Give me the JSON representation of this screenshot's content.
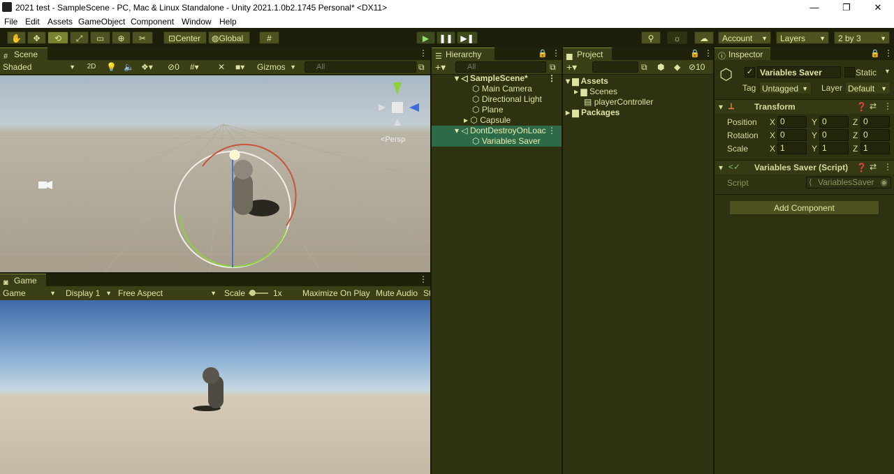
{
  "window": {
    "title": "2021 test - SampleScene - PC, Mac & Linux Standalone - Unity 2021.1.0b2.1745 Personal* <DX11>",
    "controls": {
      "minimize": "—",
      "restore": "❐",
      "close": "✕"
    }
  },
  "menu": [
    "File",
    "Edit",
    "Assets",
    "GameObject",
    "Component",
    "Window",
    "Help"
  ],
  "toolbar": {
    "pivot_label": "Center",
    "space_label": "Global",
    "account_label": "Account",
    "layers_label": "Layers",
    "layout_label": "2 by 3"
  },
  "scene": {
    "tab": "Scene",
    "shading": "Shaded",
    "mode_2d": "2D",
    "hidden_count": "0",
    "gizmos": "Gizmos",
    "search_placeholder": "All",
    "persp_label": "<Persp"
  },
  "game": {
    "tab": "Game",
    "view_dropdown": "Game",
    "display": "Display 1",
    "aspect": "Free Aspect",
    "scale_label": "Scale",
    "scale_value": "1x",
    "maximize": "Maximize On Play",
    "mute": "Mute Audio",
    "stats_cut": "St"
  },
  "hierarchy": {
    "tab": "Hierarchy",
    "search_placeholder": "All",
    "rows": [
      {
        "label": "SampleScene*"
      },
      {
        "label": "Main Camera"
      },
      {
        "label": "Directional Light"
      },
      {
        "label": "Plane"
      },
      {
        "label": "Capsule"
      },
      {
        "label": "DontDestroyOnLoac"
      },
      {
        "label": "Variables Saver"
      }
    ]
  },
  "project": {
    "tab": "Project",
    "hidden_count": "10",
    "tree": [
      {
        "label": "Assets"
      },
      {
        "label": "Scenes"
      },
      {
        "label": "playerController"
      },
      {
        "label": "Packages"
      }
    ]
  },
  "inspector": {
    "tab": "Inspector",
    "object_name": "Variables Saver",
    "static_label": "Static",
    "tag_label": "Tag",
    "tag_value": "Untagged",
    "layer_label": "Layer",
    "layer_value": "Default",
    "transform": {
      "header": "Transform",
      "position_label": "Position",
      "rotation_label": "Rotation",
      "scale_label": "Scale",
      "position": {
        "x": "0",
        "y": "0",
        "z": "0"
      },
      "rotation": {
        "x": "0",
        "y": "0",
        "z": "0"
      },
      "scale": {
        "x": "1",
        "y": "1",
        "z": "1"
      }
    },
    "script_component": {
      "header": "Variables Saver (Script)",
      "script_label": "Script",
      "script_value": "VariablesSaver"
    },
    "add_component": "Add Component"
  },
  "axis_labels": {
    "x": "X",
    "y": "Y",
    "z": "Z"
  },
  "colors": {
    "accent_play": "#8fe06a",
    "selection": "#2d6b48",
    "panel": "#2f3211"
  }
}
